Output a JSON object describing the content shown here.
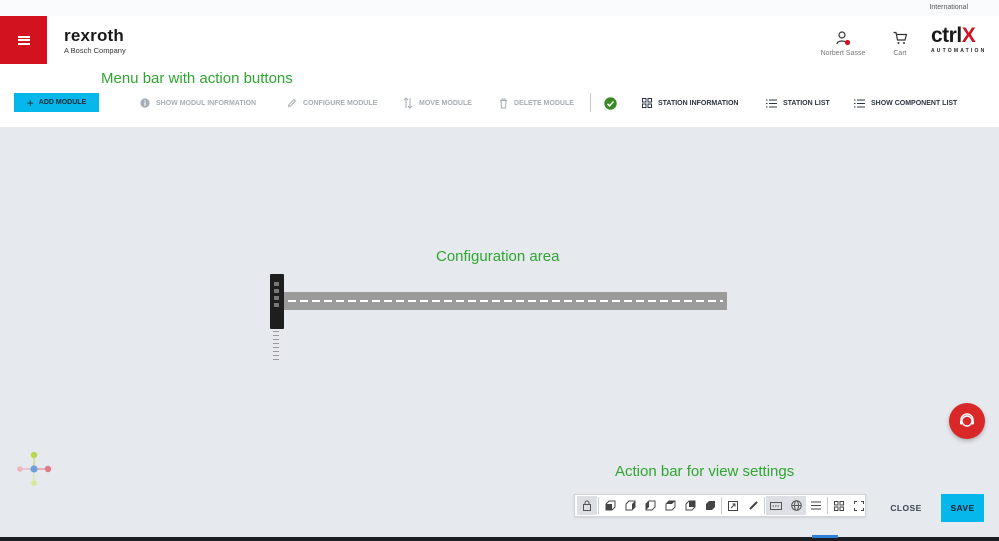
{
  "topbar": {
    "region": "International"
  },
  "header": {
    "brand": {
      "name": "rexroth",
      "subtitle": "A Bosch Company"
    },
    "user": {
      "name": "Norbert Sasse",
      "icon": "user-icon"
    },
    "cart": {
      "label": "Cart",
      "icon": "cart-icon"
    },
    "product_logo": {
      "name_main": "ctrl",
      "name_accent": "X",
      "subtitle": "AUTOMATION"
    },
    "menu_icon": "hamburger-icon",
    "accent_color": "#d2131f"
  },
  "annotations": {
    "menu_bar": "Menu bar with action buttons",
    "config_area": "Configuration area",
    "action_bar": "Action bar for view settings"
  },
  "toolbar": {
    "add_module": "ADD MODULE",
    "show_module_info": "SHOW MODUL INFORMATION",
    "configure_module": "CONFIGURE MODULE",
    "move_module": "MOVE MODULE",
    "delete_module": "DELETE MODULE",
    "station_information": "STATION INFORMATION",
    "station_list": "STATION LIST",
    "show_component_list": "SHOW COMPONENT LIST",
    "status_icon": "check-circle-icon",
    "status_color": "#3a8a26",
    "button_color": "#06b7ec"
  },
  "action_bar": {
    "buttons": [
      {
        "icon": "lock-icon",
        "active": true
      },
      {
        "icon": "view-front-icon",
        "active": false
      },
      {
        "icon": "view-left-icon",
        "active": false
      },
      {
        "icon": "view-right-icon",
        "active": false
      },
      {
        "icon": "view-top-icon",
        "active": false
      },
      {
        "icon": "view-back-icon",
        "active": false
      },
      {
        "icon": "view-iso-icon",
        "active": false
      },
      {
        "icon": "zoom-fit-icon",
        "active": false
      },
      {
        "icon": "measure-icon",
        "active": false
      },
      {
        "icon": "show-labels-icon",
        "active": true
      },
      {
        "icon": "sphere-view-icon",
        "active": true
      },
      {
        "icon": "list-icon",
        "active": false
      },
      {
        "icon": "grid-icon",
        "active": false
      },
      {
        "icon": "fullscreen-icon",
        "active": false
      }
    ],
    "close": "CLOSE",
    "save": "SAVE"
  },
  "help_button": {
    "icon": "support-headset-icon",
    "color": "#d92828"
  }
}
